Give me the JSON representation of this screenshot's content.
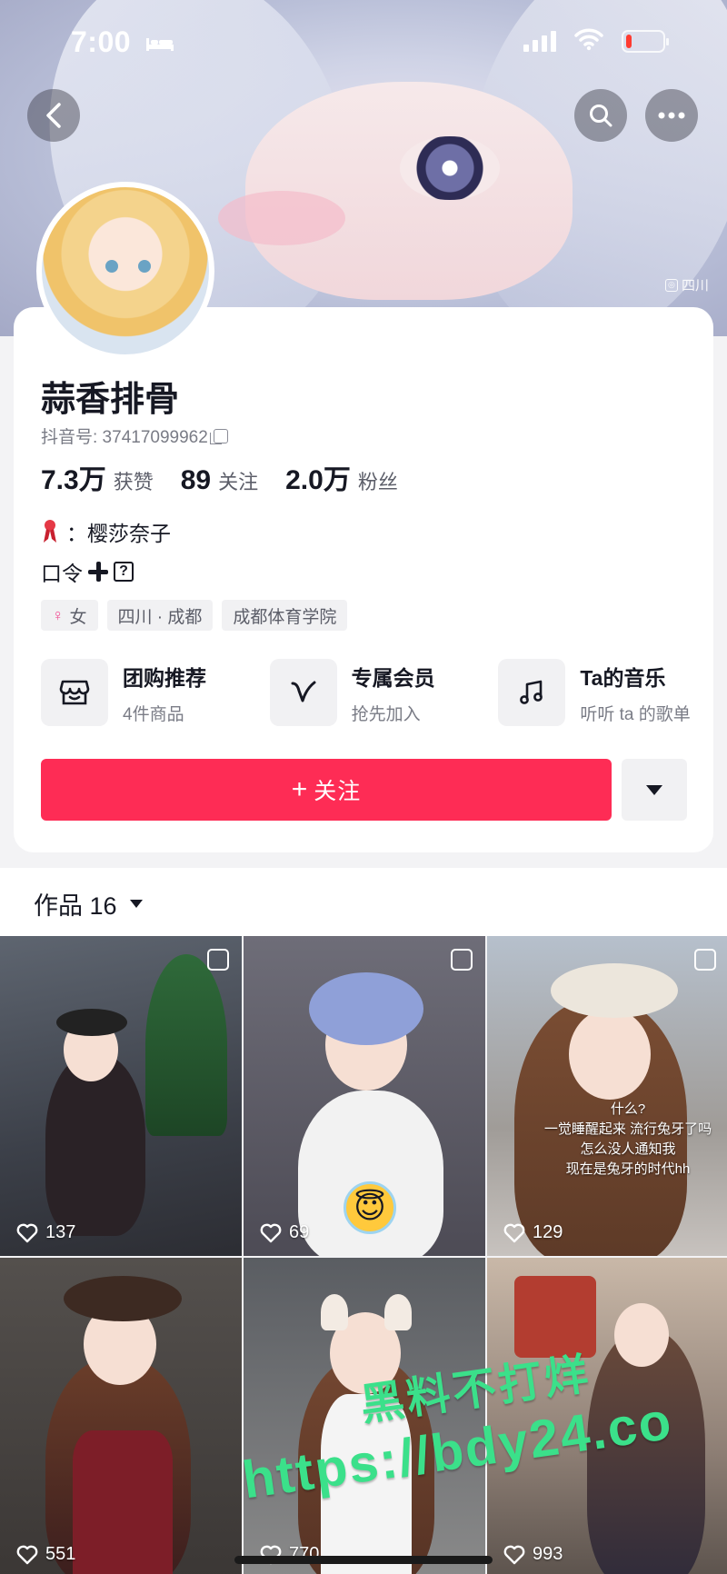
{
  "status_bar": {
    "time": "7:00",
    "battery_level": 0.1
  },
  "banner": {
    "location": "四川"
  },
  "profile": {
    "name": "蒜香排骨",
    "douyin_id": "抖音号: 37417099962",
    "stats": [
      {
        "value": "7.3万",
        "label": "获赞"
      },
      {
        "value": "89",
        "label": "关注"
      },
      {
        "value": "2.0万",
        "label": "粉丝"
      }
    ],
    "bio_line1": "：樱莎奈子",
    "bio_line2": "口令",
    "tags": {
      "gender": "女",
      "location": "四川 · 成都",
      "school": "成都体育学院"
    }
  },
  "entries": [
    {
      "title": "团购推荐",
      "subtitle": "4件商品",
      "icon": "shop-icon"
    },
    {
      "title": "专属会员",
      "subtitle": "抢先加入",
      "icon": "v-icon"
    },
    {
      "title": "Ta的音乐",
      "subtitle": "听听 ta 的歌单",
      "icon": "music-icon"
    }
  ],
  "actions": {
    "follow": "关注"
  },
  "works": {
    "tab_label": "作品 16",
    "items": [
      {
        "likes": "137"
      },
      {
        "likes": "69"
      },
      {
        "likes": "129",
        "caption": "什么?\n一觉睡醒起来 流行兔牙了吗\n怎么没人通知我\n现在是兔牙的时代hh"
      },
      {
        "likes": "551"
      },
      {
        "likes": "770"
      },
      {
        "likes": "993"
      }
    ]
  },
  "watermark": {
    "line1": "黑料不打烊",
    "line2": "https://bdy24.co"
  },
  "colors": {
    "follow": "#fe2c55",
    "text": "#161823",
    "secondary": "#7a7c86"
  }
}
